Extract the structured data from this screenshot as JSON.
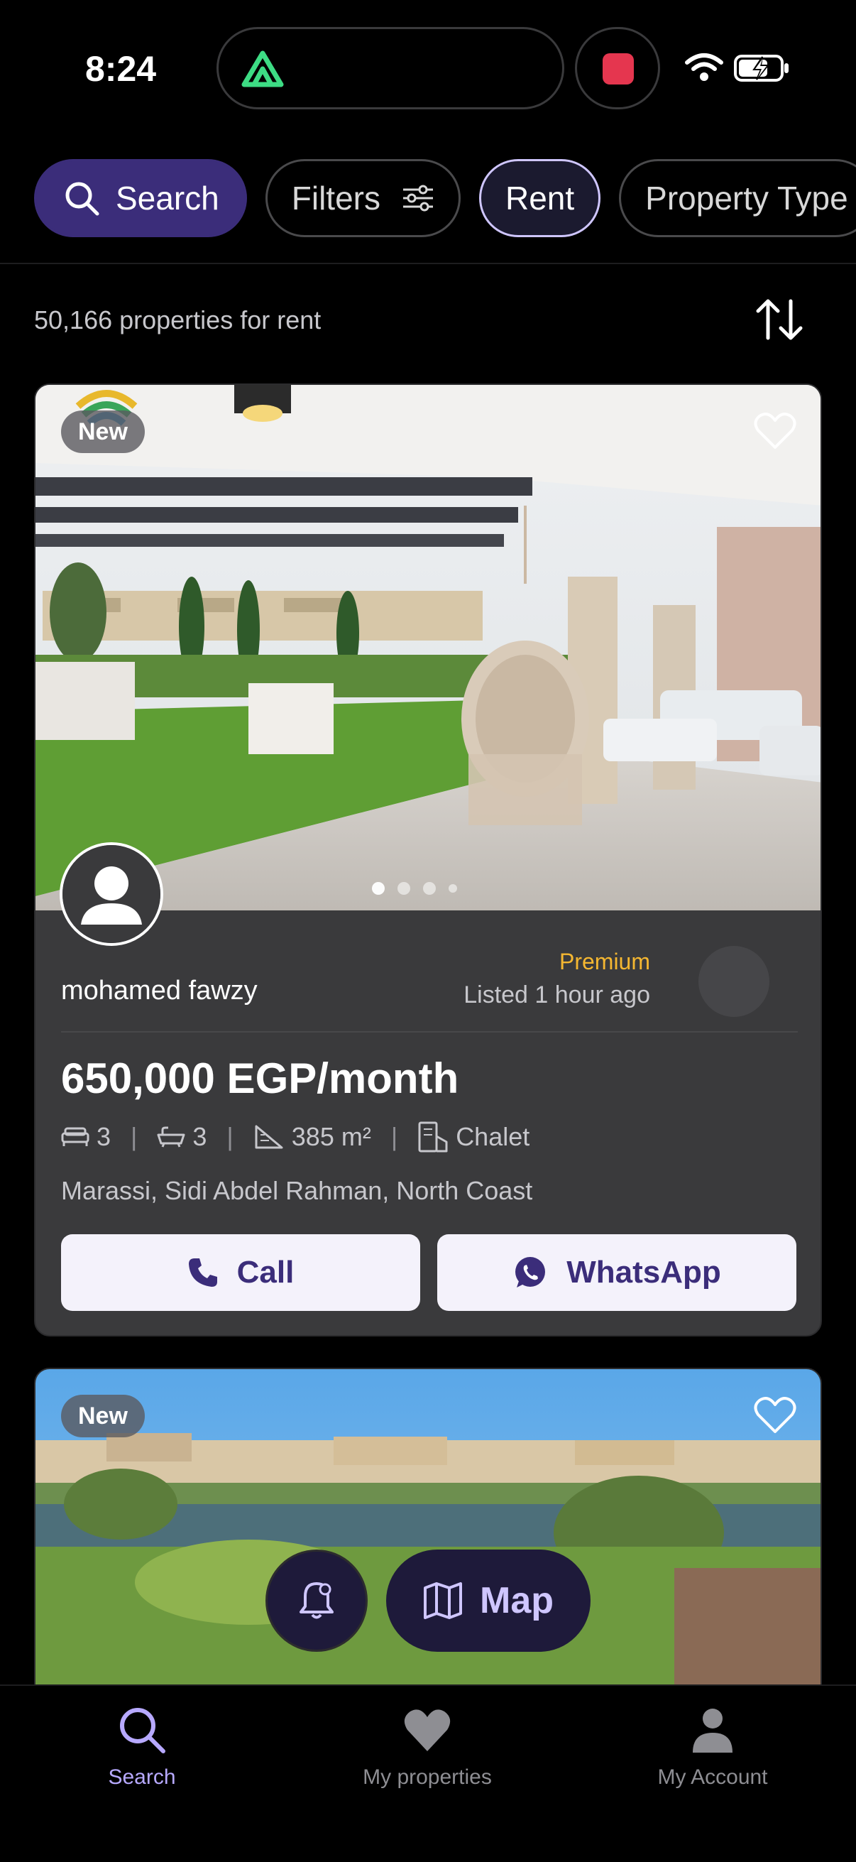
{
  "status_bar": {
    "time": "8:24"
  },
  "chips": {
    "search": "Search",
    "filters": "Filters",
    "rent": "Rent",
    "property_type": "Property Type"
  },
  "results": {
    "count_text": "50,166 properties for rent"
  },
  "listings": [
    {
      "badge": "New",
      "agent_name": "mohamed fawzy",
      "tier": "Premium",
      "listed": "Listed 1 hour ago",
      "price": "650,000 EGP/month",
      "bedrooms": "3",
      "bathrooms": "3",
      "area": "385 m²",
      "type": "Chalet",
      "location": "Marassi, Sidi Abdel Rahman, North Coast",
      "call_label": "Call",
      "whatsapp_label": "WhatsApp",
      "photo_index": 1,
      "photo_count": 4
    },
    {
      "badge": "New"
    }
  ],
  "floating": {
    "map_label": "Map"
  },
  "tabbar": {
    "search": "Search",
    "my_properties": "My properties",
    "my_account": "My Account"
  },
  "colors": {
    "accent": "#3b2d7a",
    "accent_light": "#b7a9ff",
    "premium": "#f5b731",
    "card_bg": "#3a3a3c"
  }
}
